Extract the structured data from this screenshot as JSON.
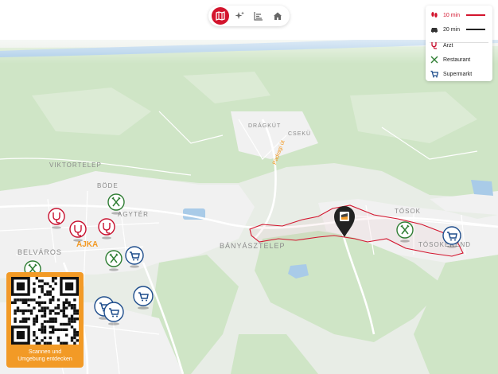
{
  "toolbar": {
    "buttons": [
      {
        "icon": "map-icon",
        "active": true
      },
      {
        "icon": "sparkle-icon",
        "active": false
      },
      {
        "icon": "list-icon",
        "active": false
      },
      {
        "icon": "home-icon",
        "active": false
      }
    ]
  },
  "legend": {
    "walk_label": "10 min",
    "car_label": "20 min",
    "doctor_label": "Arzt",
    "restaurant_label": "Restaurant",
    "supermarket_label": "Supermarkt"
  },
  "map": {
    "labels": {
      "dragkut": "DRÁGKÚT",
      "cseku": "CSEKÜ",
      "viktortelep": "VIKTORTELEP",
      "bode": "BÖDE",
      "agyter": "AGYTÉR",
      "belvaros": "BELVÁROS",
      "banyaszteleр": "BÁNYÁSZTELEP",
      "tosok": "TÓSOK",
      "tosokerend": "TÓSOKERÉND",
      "ajka": "AJKA",
      "padragi_ut": "Padragi út"
    }
  },
  "colors": {
    "accent": "#d3142d",
    "doctor": "#c8102e",
    "restaurant": "#2e7d32",
    "supermarket": "#1e4d8c",
    "qr_card": "#f29a26"
  },
  "qr": {
    "caption_line1": "Scannen und",
    "caption_line2": "Umgebung entdecken"
  }
}
